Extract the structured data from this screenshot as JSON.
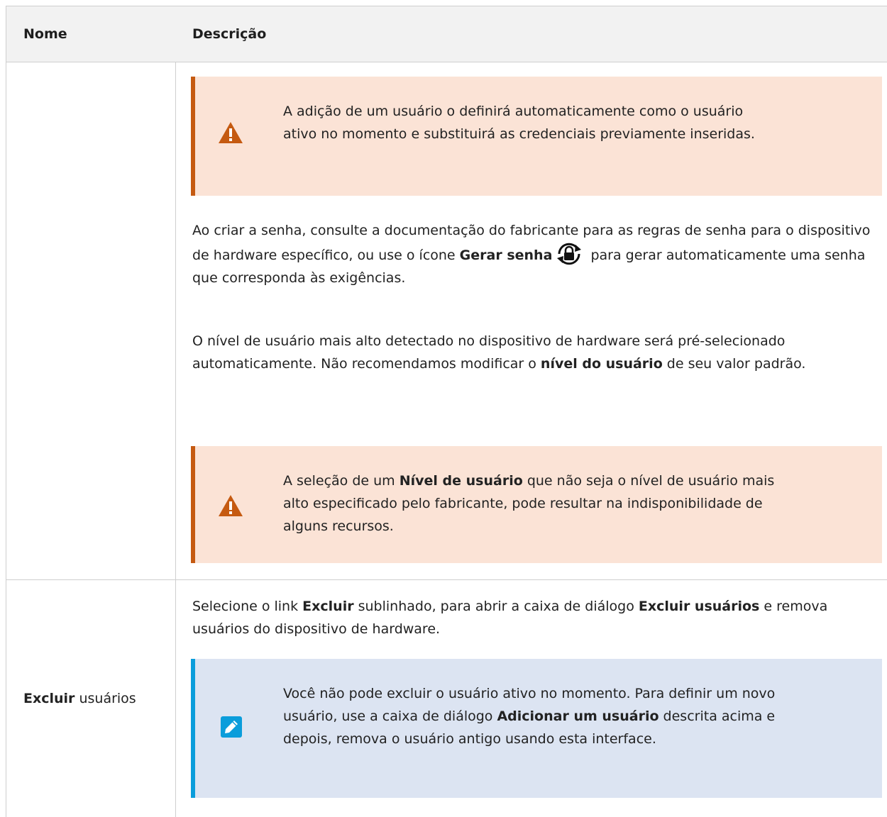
{
  "header": {
    "col1": "Nome",
    "col2": "Descrição"
  },
  "row1": {
    "warning1": "A adição de um usuário o definirá automaticamente como o usuário ativo no momento e substituirá as credenciais previamente inseridas.",
    "para1": {
      "before": "Ao criar a senha, consulte a documentação do fabricante para as regras de senha para o dispositivo de hardware específico, ou use o ícone ",
      "bold": "Gerar senha",
      "after": " para gerar automaticamente uma senha que corresponda às exigências."
    },
    "para2": {
      "before": "O nível de usuário mais alto detectado no dispositivo de hardware será pré-selecionado automaticamente. Não recomendamos modificar o ",
      "bold": "nível do usuário",
      "after": " de seu valor padrão."
    },
    "warning2": {
      "before": "A seleção de um ",
      "bold": "Nível de usuário",
      "after": " que não seja o nível de usuário mais alto especificado pelo fabricante, pode resultar na indisponibilidade de alguns recursos."
    }
  },
  "row2": {
    "name": {
      "bold": "Excluir",
      "rest": " usuários"
    },
    "para": {
      "before": "Selecione o link ",
      "bold1": "Excluir",
      "middle": " sublinhado, para abrir a caixa de diálogo ",
      "bold2": "Excluir usuários",
      "after": " e remova usuários do dispositivo de hardware."
    },
    "note": {
      "before": "Você não pode excluir o usuário ativo no momento. Para definir um novo usuário, use a caixa de diálogo ",
      "bold": "Adicionar um usuário",
      "after": " descrita acima e depois, remova o usuário antigo usando esta interface."
    }
  },
  "colors": {
    "warning_bg": "#fbe3d6",
    "warning_accent": "#c55a11",
    "note_bg": "#dce4f2",
    "note_accent": "#0b9ddb"
  },
  "icons": {
    "warning": "warning-triangle-icon",
    "generate_password": "generate-password-icon",
    "note": "pencil-icon"
  }
}
